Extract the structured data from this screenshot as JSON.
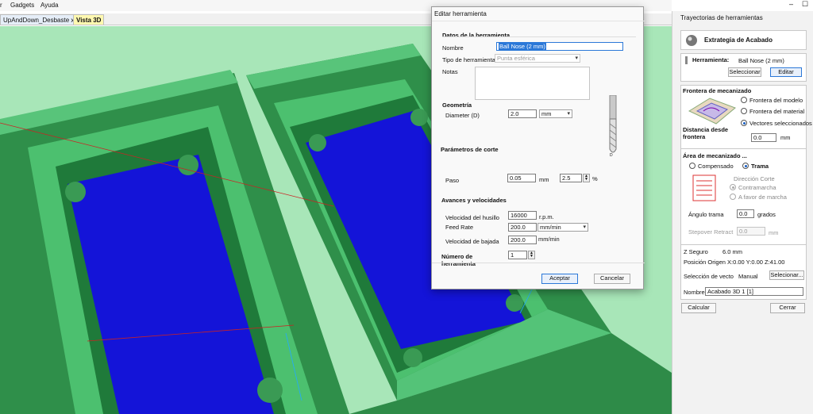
{
  "menu": {
    "items": [
      "r",
      "Gadgets",
      "Ayuda"
    ]
  },
  "tabs": [
    {
      "label": "UpAndDown_Desbaste x2"
    },
    {
      "label": "Vista 3D"
    }
  ],
  "window_controls": {
    "minimize": "–",
    "pin": "☐"
  },
  "right_panel": {
    "title": "Trayectorias de herramientas",
    "strategy": "Extrategia de Acabado",
    "tool": {
      "label": "Herramienta:",
      "name": "Ball Nose (2 mm)",
      "select_btn": "Seleccionar",
      "edit_btn": "Editar"
    },
    "frontier": {
      "title": "Frontera de mecanizado",
      "options": [
        "Frontera del modelo",
        "Frontera del material",
        "Vectores seleccionados"
      ],
      "selected": 2,
      "distance_label": "Distancia desde frontera",
      "distance_value": "0.0",
      "distance_unit": "mm"
    },
    "area": {
      "title": "Área de mecanizado ...",
      "options": [
        "Compensado",
        "Trama"
      ],
      "selected": 1,
      "direction_label": "Dirección Corte",
      "direction_options": [
        "Contramarcha",
        "A favor de marcha"
      ],
      "direction_selected": 0,
      "angle_label": "Ángulo trama",
      "angle_value": "0.0",
      "angle_unit": "grados",
      "stepover_label": "Stepover Retract",
      "stepover_value": "0.0",
      "stepover_unit": "mm"
    },
    "info": {
      "zsafe_label": "Z Seguro",
      "zsafe_value": "6.0 mm",
      "origin": "Posición Origen X:0.00 Y:0.00 Z:41.00",
      "vector_sel_label": "Selección de vecto",
      "vector_sel_value": "Manual",
      "vector_sel_btn": "Selecionar...",
      "name_label": "Nombre:",
      "name_value": "Acabado 3D 1 [1]"
    },
    "calc_btn": "Calcular",
    "close_btn": "Cerrar"
  },
  "dialog": {
    "title": "Editar herramienta",
    "tool_data": {
      "heading": "Datos de la herramienta",
      "name_label": "Nombre",
      "name_value": "Ball Nose (2 mm)",
      "type_label": "Tipo de herramienta",
      "type_value": "Punta esférica",
      "notes_label": "Notas"
    },
    "geometry": {
      "heading": "Geometría",
      "diameter_label": "Diameter (D)",
      "diameter_value": "2.0",
      "diameter_unit": "mm",
      "image_label": "D"
    },
    "cutting": {
      "heading": "Parámetros de corte",
      "step_label": "Paso",
      "step_value": "0.05",
      "step_unit": "mm",
      "step_percent": "2.5",
      "percent_sign": "%"
    },
    "feeds": {
      "heading": "Avances y velocidades",
      "spindle_label": "Velocidad del husillo",
      "spindle_value": "16000",
      "spindle_unit": "r.p.m.",
      "feed_label": "Feed Rate",
      "feed_value": "200.0",
      "feed_unit": "mm/min",
      "plunge_label": "Velocidad de bajada",
      "plunge_value": "200.0",
      "plunge_unit": "mm/min"
    },
    "tool_number": {
      "label": "Número de herramienta",
      "value": "1"
    },
    "accept_btn": "Aceptar",
    "cancel_btn": "Cancelar"
  },
  "colors": {
    "background": "#a8e6b8",
    "part": "#3fae60",
    "toolpath": "#1414d8",
    "accent": "#2b78d8"
  }
}
